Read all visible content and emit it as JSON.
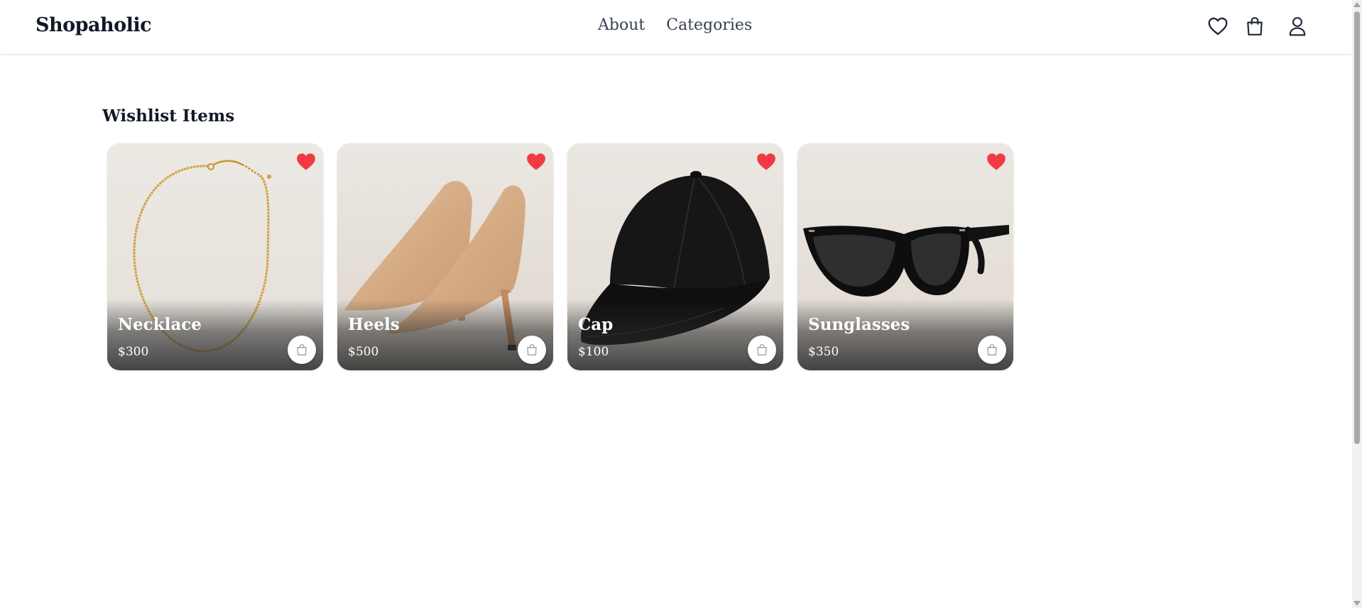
{
  "header": {
    "brand": "Shopaholic",
    "nav": [
      {
        "label": "About"
      },
      {
        "label": "Categories"
      }
    ],
    "icons": [
      "heart-icon",
      "shopping-bag-icon",
      "user-icon"
    ]
  },
  "main": {
    "title": "Wishlist Items",
    "items": [
      {
        "name": "Necklace",
        "price": "$300",
        "image": "gold-chain-necklace"
      },
      {
        "name": "Heels",
        "price": "$500",
        "image": "beige-pointed-heels"
      },
      {
        "name": "Cap",
        "price": "$100",
        "image": "black-baseball-cap"
      },
      {
        "name": "Sunglasses",
        "price": "$350",
        "image": "black-sunglasses"
      }
    ]
  },
  "colors": {
    "favorite": "#f23a45",
    "text": "#111827",
    "nav_text": "#374151",
    "card_bg": "#e9e5df"
  }
}
